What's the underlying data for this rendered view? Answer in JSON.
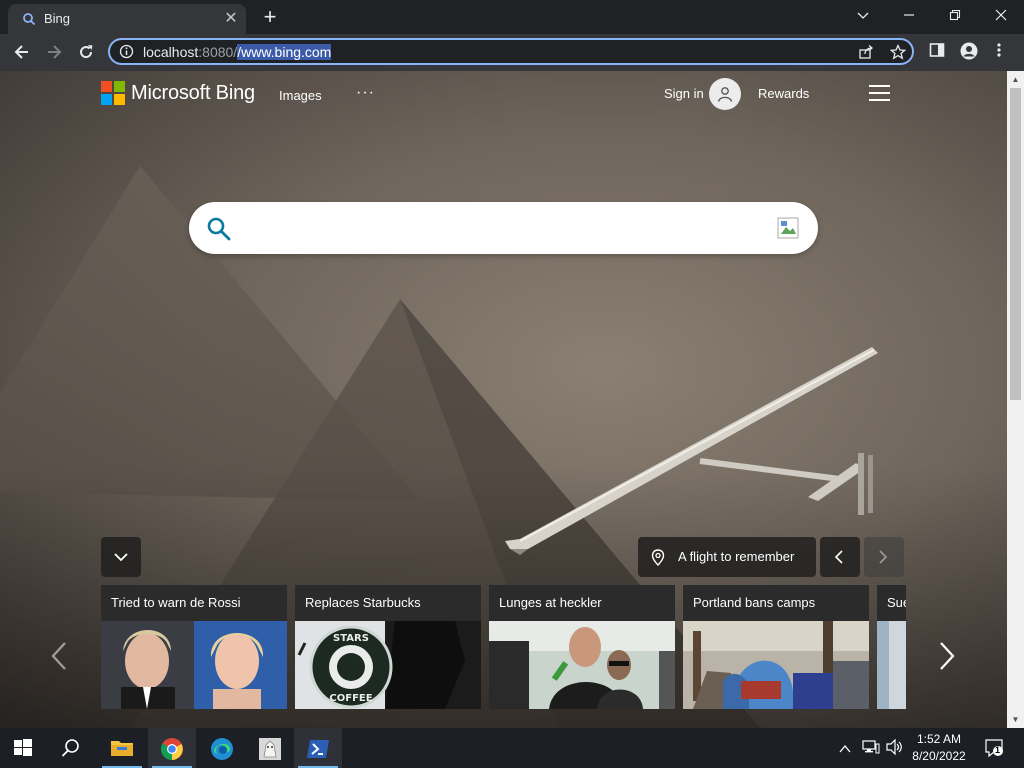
{
  "browser": {
    "tab": {
      "title": "Bing"
    },
    "address": {
      "host": "localhost",
      "port": ":8080/",
      "path": "/www.bing.com"
    }
  },
  "bing": {
    "brand": "Microsoft Bing",
    "nav": {
      "images": "Images",
      "more": "···",
      "signin": "Sign in",
      "rewards": "Rewards"
    },
    "search": {
      "value": "",
      "placeholder": ""
    },
    "image_caption": "A flight to remember",
    "news": [
      {
        "title": "Tried to warn de Rossi"
      },
      {
        "title": "Replaces Starbucks"
      },
      {
        "title": "Lunges at heckler"
      },
      {
        "title": "Portland bans camps"
      },
      {
        "title": "Sue"
      }
    ],
    "starbucks_badge": {
      "top": "STARS",
      "bottom": "COFFEE"
    }
  },
  "taskbar": {
    "time": "1:52 AM",
    "date": "8/20/2022",
    "notifications": "1"
  },
  "colors": {
    "chrome_dark": "#202124",
    "chrome_toolbar": "#35363a",
    "focus_ring": "#8ab4f8",
    "bing_search_icon": "#0c7a9f"
  }
}
